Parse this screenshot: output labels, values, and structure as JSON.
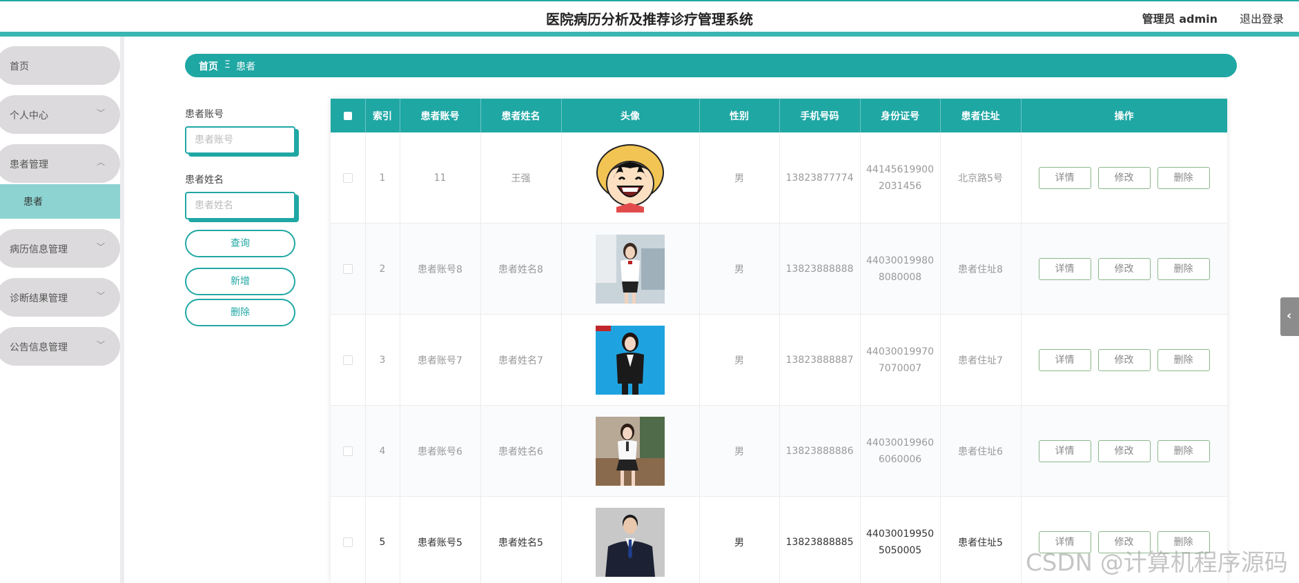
{
  "header": {
    "title": "医院病历分析及推荐诊疗管理系统",
    "admin_label": "管理员 admin",
    "logout_label": "退出登录"
  },
  "sidebar": {
    "items": [
      {
        "label": "首页",
        "has_chevron": false
      },
      {
        "label": "个人中心",
        "has_chevron": true,
        "chevron": "﹀"
      },
      {
        "label": "患者管理",
        "has_chevron": true,
        "chevron": "︿"
      },
      {
        "label": "病历信息管理",
        "has_chevron": true,
        "chevron": "﹀"
      },
      {
        "label": "诊断结果管理",
        "has_chevron": true,
        "chevron": "﹀"
      },
      {
        "label": "公告信息管理",
        "has_chevron": true,
        "chevron": "﹀"
      }
    ],
    "active_sub": {
      "label": "患者"
    }
  },
  "breadcrumb": {
    "home": "首页",
    "separator": "Ξ",
    "current": "患者"
  },
  "search": {
    "account_label": "患者账号",
    "account_placeholder": "患者账号",
    "account_value": "",
    "name_label": "患者姓名",
    "name_placeholder": "患者姓名",
    "name_value": "",
    "query_label": "查询",
    "add_label": "新增",
    "delete_label": "删除"
  },
  "table": {
    "columns": [
      "",
      "索引",
      "患者账号",
      "患者姓名",
      "头像",
      "性别",
      "手机号码",
      "身份证号",
      "患者住址",
      "操作"
    ],
    "action_labels": {
      "detail": "详情",
      "edit": "修改",
      "delete": "删除"
    },
    "rows": [
      {
        "index": "1",
        "account": "11",
        "name": "王强",
        "avatar_icon": "cartoon-avatar",
        "gender": "男",
        "phone": "13823877774",
        "id_line1": "44145619900",
        "id_line2": "2031456",
        "address": "北京路5号"
      },
      {
        "index": "2",
        "account": "患者账号8",
        "name": "患者姓名8",
        "avatar_icon": "woman-photo",
        "gender": "男",
        "phone": "13823888888",
        "id_line1": "44030019980",
        "id_line2": "8080008",
        "address": "患者住址8"
      },
      {
        "index": "3",
        "account": "患者账号7",
        "name": "患者姓名7",
        "avatar_icon": "woman-blue-bg-photo",
        "gender": "男",
        "phone": "13823888887",
        "id_line1": "44030019970",
        "id_line2": "7070007",
        "address": "患者住址7"
      },
      {
        "index": "4",
        "account": "患者账号6",
        "name": "患者姓名6",
        "avatar_icon": "woman-seated-photo",
        "gender": "男",
        "phone": "13823888886",
        "id_line1": "44030019960",
        "id_line2": "6060006",
        "address": "患者住址6"
      },
      {
        "index": "5",
        "account": "患者账号5",
        "name": "患者姓名5",
        "avatar_icon": "man-suit-photo",
        "gender": "男",
        "phone": "13823888885",
        "id_line1": "44030019950",
        "id_line2": "5050005",
        "address": "患者住址5"
      }
    ]
  },
  "float_tab_icon": "chevron-left-icon",
  "watermark": "CSDN @计算机程序源码",
  "colors": {
    "accent": "#1fa7a4",
    "sub_active": "#8cd3d1",
    "menu_bg": "#dcdadc"
  }
}
